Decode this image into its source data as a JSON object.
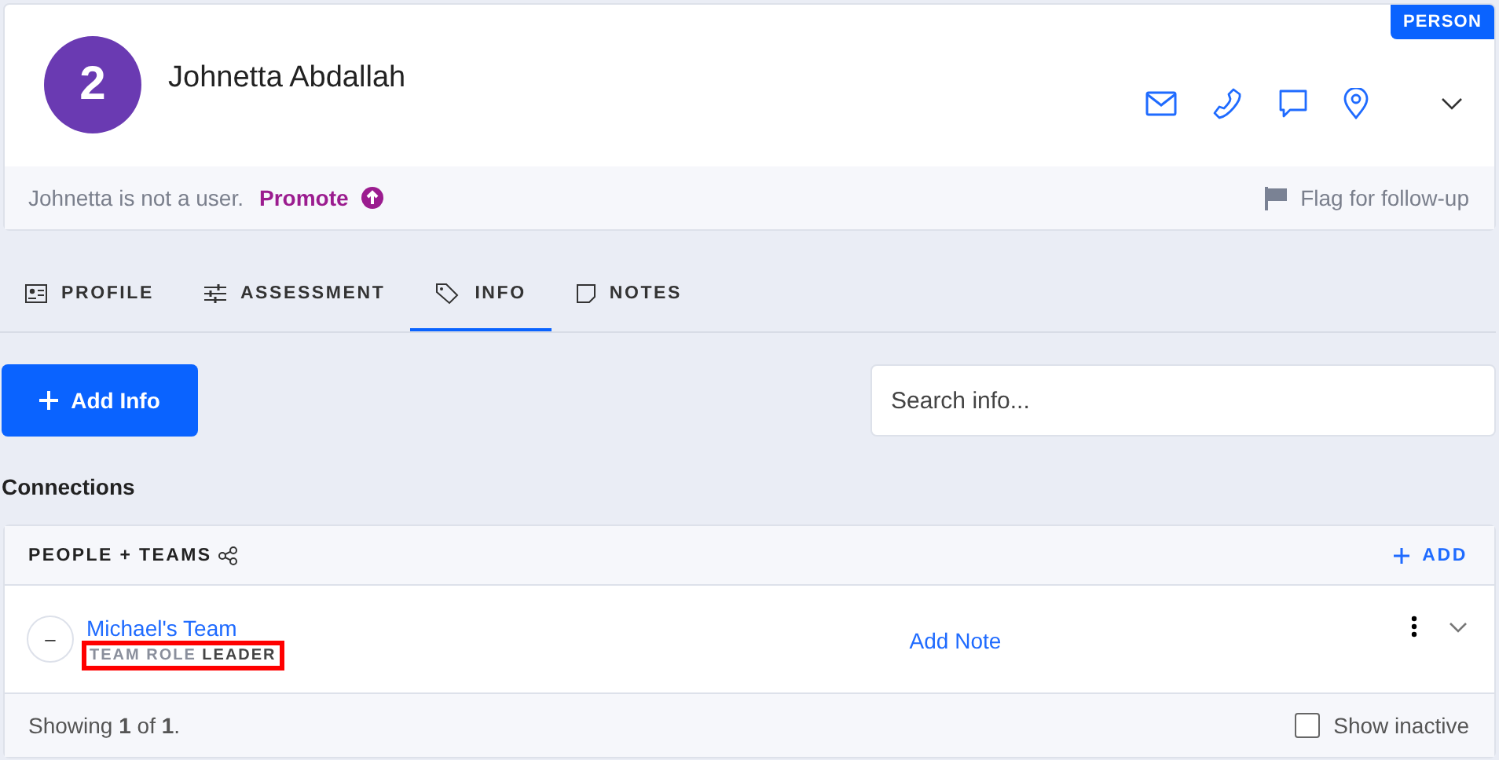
{
  "person": {
    "avatar": "2",
    "name": "Johnetta Abdallah",
    "badge": "PERSON"
  },
  "status": {
    "text": "Johnetta is not a user.",
    "promote": "Promote",
    "flag": "Flag for follow-up"
  },
  "tabs": [
    {
      "label": "PROFILE",
      "kind": "profile",
      "selected": false
    },
    {
      "label": "ASSESSMENT",
      "kind": "assessment",
      "selected": false
    },
    {
      "label": "INFO",
      "kind": "info",
      "selected": true
    },
    {
      "label": "NOTES",
      "kind": "notes",
      "selected": false
    }
  ],
  "add_button": "Add Info",
  "search": {
    "placeholder": "Search info..."
  },
  "section_title": "Connections",
  "connections": {
    "title": "PEOPLE + TEAMS",
    "add": "ADD",
    "rows": [
      {
        "avatar": "–",
        "name": "Michael's Team",
        "role_label": "TEAM ROLE",
        "role": "LEADER",
        "highlighted": true,
        "action": "Add Note"
      }
    ],
    "footer": "Showing **1** of **1**.",
    "show_inactive": {
      "label": "Show inactive",
      "checked": false
    }
  }
}
